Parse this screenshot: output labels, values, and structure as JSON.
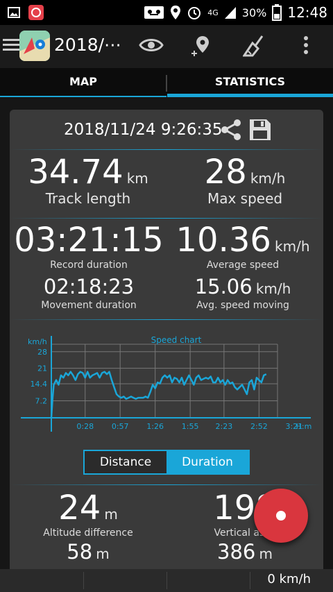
{
  "status_bar": {
    "time": "12:48",
    "battery": "30%",
    "network": "4G",
    "icons": [
      "image-icon",
      "app-notification-icon",
      "voicemail-icon",
      "location-icon",
      "alarm-icon",
      "signal-icon",
      "battery-icon"
    ]
  },
  "toolbar": {
    "title": "2018/⋯",
    "icons": [
      "menu-icon",
      "app-logo",
      "eye-icon",
      "add-location-icon",
      "broom-icon",
      "overflow-menu-icon"
    ]
  },
  "tabs": [
    {
      "label": "MAP",
      "active": false
    },
    {
      "label": "STATISTICS",
      "active": true
    }
  ],
  "card": {
    "datetime": "2018/11/24 9:26:35",
    "track_length": {
      "value": "34.74",
      "unit": "km",
      "label": "Track length"
    },
    "max_speed": {
      "value": "28",
      "unit": "km/h",
      "label": "Max speed"
    },
    "record_duration": {
      "value": "03:21:15",
      "label": "Record duration"
    },
    "average_speed": {
      "value": "10.36",
      "unit": "km/h",
      "label": "Average speed"
    },
    "movement_duration": {
      "value": "02:18:23",
      "label": "Movement duration"
    },
    "avg_speed_moving": {
      "value": "15.06",
      "unit": "km/h",
      "label": "Avg. speed moving"
    },
    "altitude_difference": {
      "value": "24",
      "unit": "m",
      "label": "Altitude difference"
    },
    "vertical_ascent": {
      "value": "198",
      "unit": "m",
      "label": "Vertical asce"
    },
    "second_row_left": {
      "value": "58",
      "unit": "m"
    },
    "second_row_right": {
      "value": "386",
      "unit": "m"
    }
  },
  "chart_data": {
    "type": "line",
    "title": "Speed chart",
    "ylabel": "km/h",
    "xlabel": "H:m",
    "y_ticks": [
      "28",
      "21",
      "14.4",
      "7.2"
    ],
    "y_tick_values": [
      28,
      21,
      14.4,
      7.2
    ],
    "x_ticks": [
      "0:28",
      "0:57",
      "1:26",
      "1:55",
      "2:23",
      "2:52",
      "3:21"
    ],
    "x_tick_minutes": [
      28,
      57,
      86,
      115,
      143,
      172,
      201
    ],
    "xlim": [
      0,
      208
    ],
    "ylim": [
      0,
      30
    ],
    "grid": true,
    "series": [
      {
        "color": "#1aa6d8",
        "x": [
          0,
          1,
          2,
          4,
          6,
          8,
          10,
          12,
          14,
          16,
          18,
          20,
          22,
          24,
          26,
          28,
          30,
          32,
          34,
          36,
          38,
          40,
          42,
          44,
          46,
          48,
          50,
          52,
          54,
          56,
          58,
          60,
          62,
          64,
          66,
          68,
          70,
          72,
          74,
          76,
          78,
          80,
          82,
          84,
          86,
          88,
          90,
          92,
          94,
          96,
          98,
          100,
          102,
          104,
          106,
          108,
          110,
          112,
          114,
          116,
          118,
          120,
          122,
          124,
          126,
          128,
          130,
          132,
          134,
          136,
          138,
          140,
          142,
          144,
          146,
          148,
          150,
          152,
          154,
          156,
          158,
          160,
          162,
          164,
          166,
          168,
          170,
          172,
          174,
          176,
          178
        ],
        "y": [
          0,
          8,
          14,
          16,
          14,
          18,
          17,
          19,
          18,
          19.5,
          18,
          16,
          18.5,
          19.5,
          19,
          17,
          19.5,
          17,
          18,
          18.5,
          19,
          17,
          19,
          19.5,
          18.5,
          19.5,
          16,
          13,
          10,
          9,
          8.5,
          9,
          8,
          8.5,
          9,
          8.5,
          8,
          8.5,
          8.5,
          8.5,
          9,
          8.5,
          11,
          14,
          12.5,
          15,
          14.5,
          17,
          18,
          17,
          18,
          15,
          17,
          16.5,
          15,
          17,
          14,
          16,
          18,
          16,
          14,
          17,
          18,
          16,
          16.5,
          17,
          16.5,
          17.5,
          15,
          15,
          17,
          15,
          16,
          14,
          16,
          14.5,
          15,
          13,
          12,
          13,
          14,
          12,
          10,
          15,
          16,
          12,
          17,
          16,
          15,
          18,
          18.5
        ]
      }
    ]
  },
  "toggle": {
    "distance": "Distance",
    "duration": "Duration",
    "selected": "Duration"
  },
  "bottom": {
    "speed": "0 km/h"
  }
}
